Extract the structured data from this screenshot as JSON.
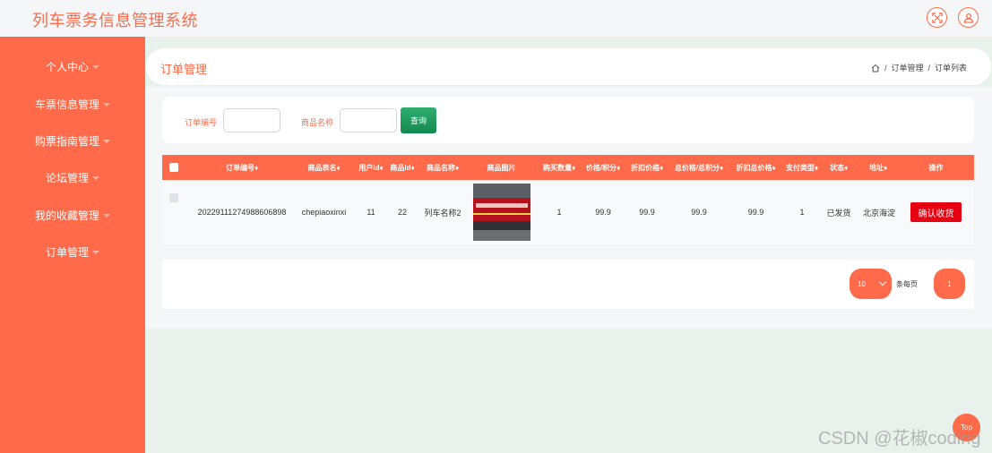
{
  "app": {
    "title": "列车票务信息管理系统"
  },
  "sidebar": {
    "items": [
      {
        "label": "个人中心"
      },
      {
        "label": "车票信息管理"
      },
      {
        "label": "购票指南管理"
      },
      {
        "label": "论坛管理"
      },
      {
        "label": "我的收藏管理"
      },
      {
        "label": "订单管理"
      }
    ]
  },
  "header": {
    "title": "订单管理",
    "breadcrumb": [
      "订单管理",
      "订单列表"
    ],
    "separator": "/"
  },
  "search": {
    "order_no_label": "订单编号",
    "order_no_value": "",
    "product_name_label": "商品名称",
    "product_name_value": "",
    "query_button": "查询"
  },
  "table": {
    "columns": [
      "订单编号",
      "商品表名",
      "用户id",
      "商品id",
      "商品名称",
      "商品图片",
      "购买数量",
      "价格/积分",
      "折扣价格",
      "总价格/总积分",
      "折扣总价格",
      "支付类型",
      "状态",
      "地址",
      "操作"
    ],
    "sort_marker": "♦",
    "rows": [
      {
        "order_no": "20229111274988606898",
        "table_name": "chepiaoxinxi",
        "user_id": "11",
        "product_id": "22",
        "product_name": "列车名称2",
        "image": "train-photo",
        "quantity": "1",
        "price": "99.9",
        "discount_price": "99.9",
        "total": "99.9",
        "discount_total": "99.9",
        "pay_type": "1",
        "status": "已发货",
        "address": "北京海淀",
        "action": "确认收货"
      }
    ]
  },
  "pagination": {
    "page_size": "10",
    "per_page_label": "条每页",
    "current_page": "1"
  },
  "back_to_top": "Top",
  "watermark": "CSDN @花椒coding",
  "colors": {
    "accent": "#ff6b4a",
    "query_green": "#128a4f",
    "confirm_red": "#e60012"
  },
  "icons": [
    "fullscreen-icon",
    "user-icon",
    "home-icon",
    "caret-down-icon",
    "chevron-down-icon"
  ]
}
